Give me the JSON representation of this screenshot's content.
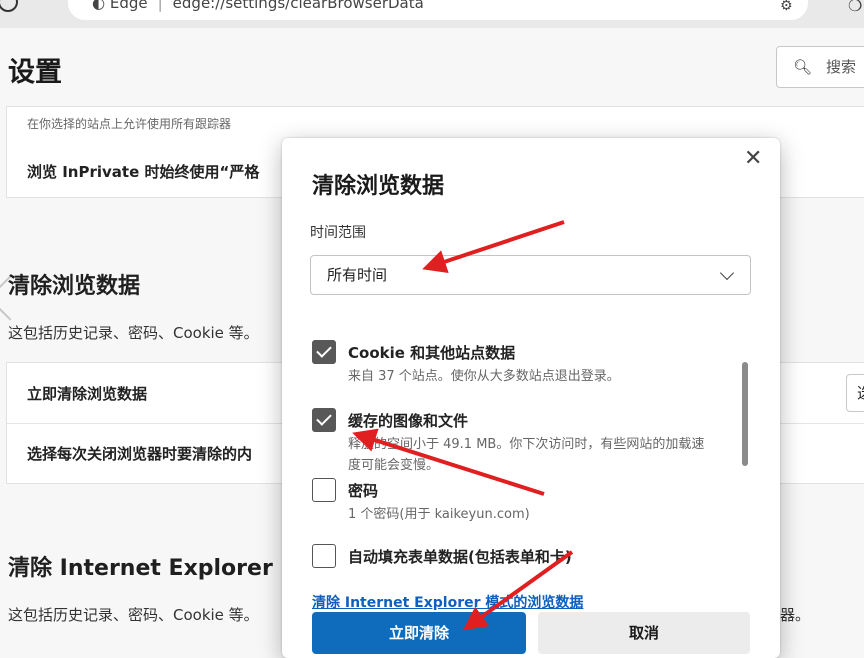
{
  "browser": {
    "brand": "Edge",
    "url": "edge://settings/clearBrowserData"
  },
  "page": {
    "title": "设置",
    "search_placeholder": "搜索"
  },
  "privacy_card": {
    "faded_text": "在你选择的站点上允许使用所有跟踪器",
    "inprivate_text": "浏览 InPrivate 时始终使用“严格"
  },
  "clear_section": {
    "title": "清除浏览数据",
    "description": "这包括历史记录、密码、Cookie 等。",
    "row1": "立即清除浏览数据",
    "row2": "选择每次关闭浏览器时要清除的内",
    "row1_button": "选"
  },
  "ie_section": {
    "title": "清除 Internet Explorer",
    "description": "这包括历史记录、密码、Cookie 等。",
    "tail": "器。"
  },
  "dialog": {
    "title": "清除浏览数据",
    "time_range_label": "时间范围",
    "time_range_value": "所有时间",
    "items": [
      {
        "title": "Cookie 和其他站点数据",
        "subtitle": "来自 37 个站点。使你从大多数站点退出登录。",
        "checked": true
      },
      {
        "title": "缓存的图像和文件",
        "subtitle": "释放的空间小于 49.1 MB。你下次访问时，有些网站的加载速度可能会变慢。",
        "checked": true
      },
      {
        "title": "密码",
        "subtitle": "1 个密码(用于 kaikeyun.com)",
        "checked": false
      },
      {
        "title": "自动填充表单数据(包括表单和卡)",
        "subtitle": "",
        "checked": false
      }
    ],
    "ie_link": "清除 Internet Explorer 模式的浏览数据",
    "confirm_button": "立即清除",
    "cancel_button": "取消"
  },
  "annotation_color": "#e02020"
}
